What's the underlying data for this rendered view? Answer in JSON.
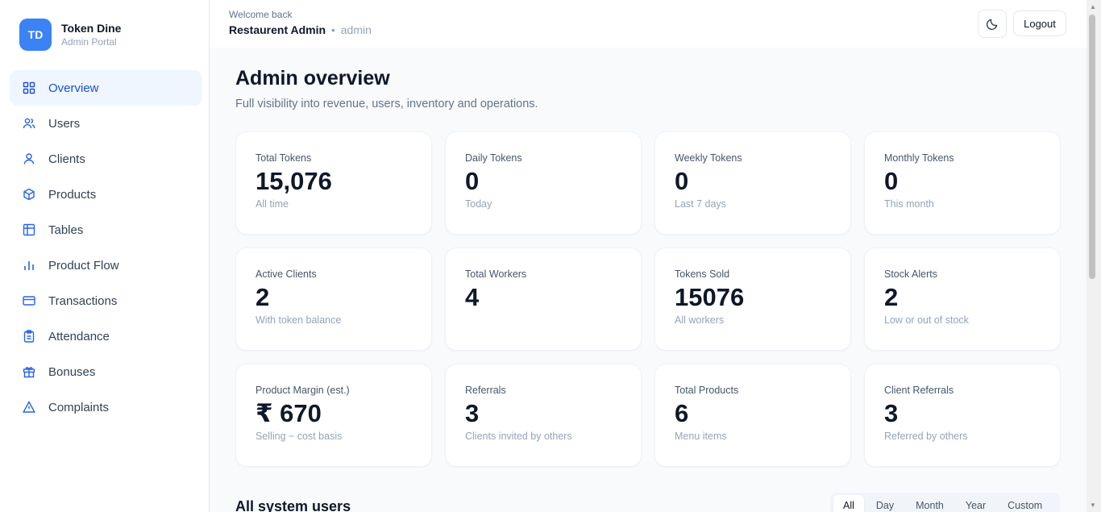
{
  "brand": {
    "initials": "TD",
    "name": "Token Dine",
    "subtitle": "Admin Portal"
  },
  "nav": [
    {
      "label": "Overview",
      "icon": "grid-icon",
      "active": true
    },
    {
      "label": "Users",
      "icon": "users-icon"
    },
    {
      "label": "Clients",
      "icon": "user-icon"
    },
    {
      "label": "Products",
      "icon": "box-icon"
    },
    {
      "label": "Tables",
      "icon": "table-icon"
    },
    {
      "label": "Product Flow",
      "icon": "bar-chart-icon"
    },
    {
      "label": "Transactions",
      "icon": "credit-card-icon"
    },
    {
      "label": "Attendance",
      "icon": "clipboard-icon"
    },
    {
      "label": "Bonuses",
      "icon": "gift-icon"
    },
    {
      "label": "Complaints",
      "icon": "alert-triangle-icon"
    }
  ],
  "header": {
    "welcome": "Welcome back",
    "name": "Restaurent Admin",
    "separator": "•",
    "role": "admin",
    "theme_icon": "moon-icon",
    "logout": "Logout"
  },
  "page": {
    "title": "Admin overview",
    "subtitle": "Full visibility into revenue, users, inventory and operations."
  },
  "stats": [
    {
      "label": "Total Tokens",
      "value": "15,076",
      "hint": "All time"
    },
    {
      "label": "Daily Tokens",
      "value": "0",
      "hint": "Today"
    },
    {
      "label": "Weekly Tokens",
      "value": "0",
      "hint": "Last 7 days"
    },
    {
      "label": "Monthly Tokens",
      "value": "0",
      "hint": "This month"
    },
    {
      "label": "Active Clients",
      "value": "2",
      "hint": "With token balance"
    },
    {
      "label": "Total Workers",
      "value": "4",
      "hint": ""
    },
    {
      "label": "Tokens Sold",
      "value": "15076",
      "hint": "All workers"
    },
    {
      "label": "Stock Alerts",
      "value": "2",
      "hint": "Low or out of stock"
    },
    {
      "label": "Product Margin (est.)",
      "value": "₹ 670",
      "hint": "Selling − cost basis"
    },
    {
      "label": "Referrals",
      "value": "3",
      "hint": "Clients invited by others"
    },
    {
      "label": "Total Products",
      "value": "6",
      "hint": "Menu items"
    },
    {
      "label": "Client Referrals",
      "value": "3",
      "hint": "Referred by others"
    }
  ],
  "users_section": {
    "title": "All system users",
    "filters": [
      {
        "label": "All",
        "active": true
      },
      {
        "label": "Day"
      },
      {
        "label": "Month"
      },
      {
        "label": "Year"
      },
      {
        "label": "Custom"
      }
    ]
  },
  "colors": {
    "accent": "#3b82f6",
    "active_bg": "#eff6ff",
    "active_text": "#1d4ed8"
  }
}
